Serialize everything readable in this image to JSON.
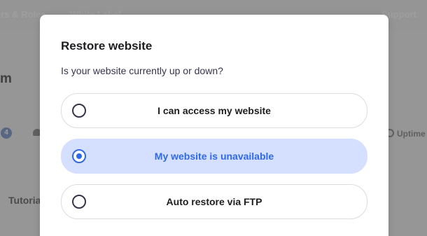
{
  "background": {
    "nav": {
      "users_roles": "ers & Roles",
      "white_label": "White Label",
      "support": "Support"
    },
    "heading_fragment": "m",
    "badge_count": "4",
    "uptime_fragment": "Uptime",
    "tutorial_fragment": "Tutoria"
  },
  "dialog": {
    "title": "Restore website",
    "question": "Is your website currently up or down?",
    "options": [
      {
        "label": "I can access my website",
        "selected": false
      },
      {
        "label": "My website is unavailable",
        "selected": true
      },
      {
        "label": "Auto restore via FTP",
        "selected": false
      }
    ]
  },
  "colors": {
    "accent": "#2f6ae6",
    "selected_bg": "#d5dfff",
    "text_dark": "#1d1e20",
    "border": "#dadce0"
  }
}
